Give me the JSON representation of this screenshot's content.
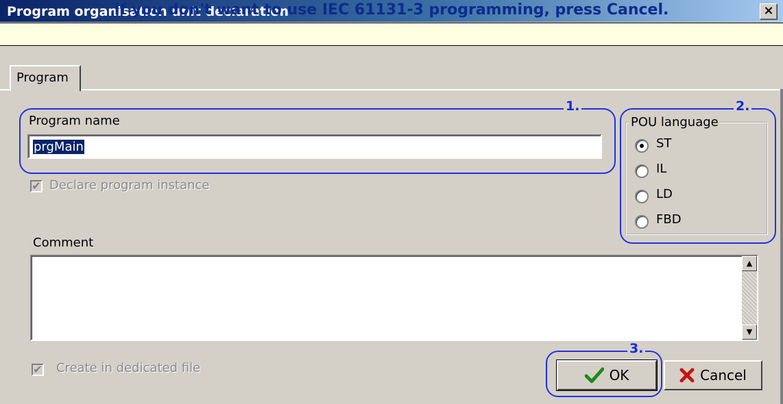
{
  "window": {
    "title": "Program organisation unit declaration",
    "close_label": "×"
  },
  "banner": {
    "text": "If you don't want to use IEC 61131-3 programming, press Cancel."
  },
  "tabs": [
    {
      "label": "Program",
      "active": true
    }
  ],
  "program_name": {
    "label": "Program name",
    "value": "prgMain"
  },
  "declare_instance": {
    "label": "Declare program instance",
    "checked": true,
    "enabled": false
  },
  "comment": {
    "label": "Comment",
    "value": ""
  },
  "dedicated_file": {
    "label": "Create in dedicated file",
    "checked": true,
    "enabled": false
  },
  "pou_language": {
    "label": "POU language",
    "selected": "ST",
    "options": [
      {
        "label": "ST"
      },
      {
        "label": "IL"
      },
      {
        "label": "LD"
      },
      {
        "label": "FBD"
      }
    ]
  },
  "buttons": {
    "ok": "OK",
    "cancel": "Cancel"
  },
  "callouts": {
    "one": "1.",
    "two": "2.",
    "three": "3."
  },
  "colors": {
    "callout": "#2231e0",
    "banner_bg": "#ffffe1",
    "banner_text": "#0b2d8c",
    "selection": "#0a246a"
  },
  "icons": {
    "ok": "checkmark-icon",
    "cancel": "x-icon"
  }
}
